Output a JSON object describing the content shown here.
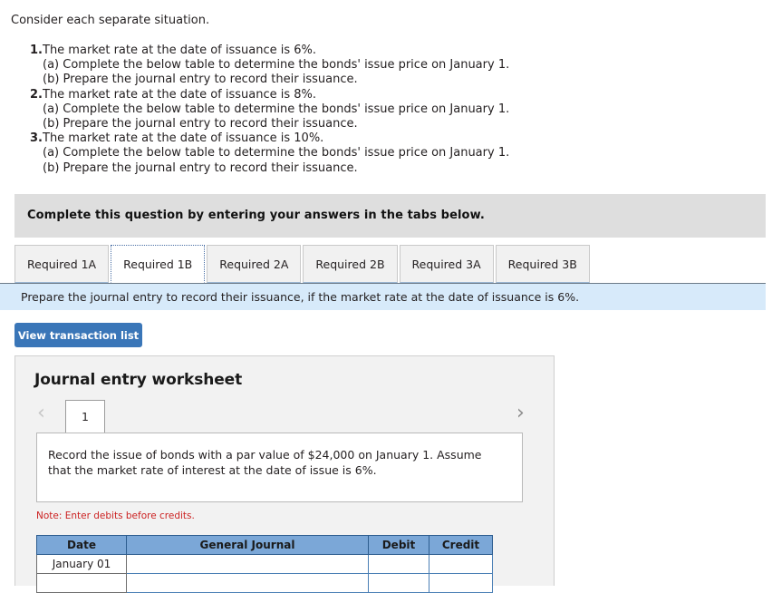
{
  "intro": {
    "text": "Consider each separate situation."
  },
  "situations": [
    {
      "num": "1.",
      "main": "The market rate at the date of issuance is 6%.",
      "sub_a": "(a) Complete the below table to determine the bonds' issue price on January 1.",
      "sub_b": "(b) Prepare the journal entry to record their issuance."
    },
    {
      "num": "2.",
      "main": "The market rate at the date of issuance is 8%.",
      "sub_a": "(a) Complete the below table to determine the bonds' issue price on January 1.",
      "sub_b": "(b) Prepare the journal entry to record their issuance."
    },
    {
      "num": "3.",
      "main": "The market rate at the date of issuance is 10%.",
      "sub_a": "(a) Complete the below table to determine the bonds' issue price on January 1.",
      "sub_b": "(b) Prepare the journal entry to record their issuance."
    }
  ],
  "banner": {
    "text": "Complete this question by entering your answers in the tabs below."
  },
  "tabs": [
    {
      "label": "Required 1A",
      "active": false
    },
    {
      "label": "Required 1B",
      "active": true
    },
    {
      "label": "Required 2A",
      "active": false
    },
    {
      "label": "Required 2B",
      "active": false
    },
    {
      "label": "Required 3A",
      "active": false
    },
    {
      "label": "Required 3B",
      "active": false
    }
  ],
  "infobar": {
    "text": "Prepare the journal entry to record their issuance, if the market rate at the date of issuance is 6%."
  },
  "toolbar": {
    "view_transaction_list": "View transaction list"
  },
  "worksheet": {
    "title": "Journal entry worksheet",
    "prev_icon": "‹",
    "next_icon": "›",
    "entry_tab_label": "1",
    "description": "Record the issue of bonds with a par value of $24,000 on January 1. Assume that the market rate of interest at the date of issue is 6%.",
    "note": "Note: Enter debits before credits."
  },
  "journal_table": {
    "headers": [
      "Date",
      "General Journal",
      "Debit",
      "Credit"
    ],
    "rows": [
      {
        "date": "January 01",
        "general_journal": "",
        "debit": "",
        "credit": ""
      },
      {
        "date": "",
        "general_journal": "",
        "debit": "",
        "credit": ""
      }
    ]
  },
  "colors": {
    "accent_blue": "#3a76b8",
    "table_header_blue": "#7ba7d7",
    "info_bar_blue": "#d7eafa",
    "banner_gray": "#dedede",
    "note_red": "#cc2222"
  }
}
